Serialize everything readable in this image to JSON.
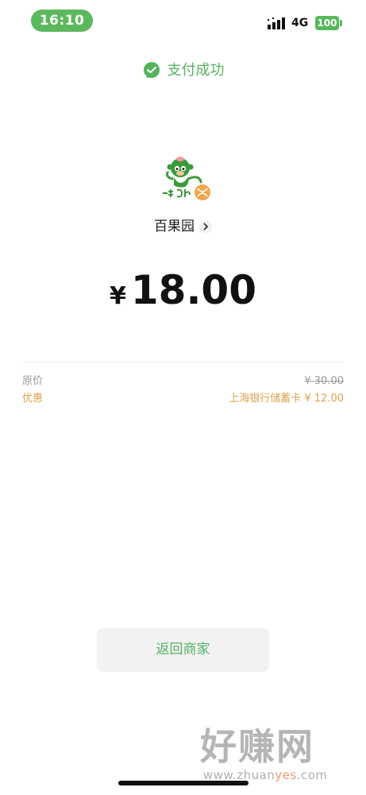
{
  "status_bar": {
    "time": "16:10",
    "network": "4G",
    "battery": "100",
    "signal_icon": "signal-bars-icon"
  },
  "header": {
    "icon": "wechat-pay-icon",
    "title": "支付成功"
  },
  "merchant": {
    "logo": "merchant-logo-monkey",
    "name": "百果园"
  },
  "payment": {
    "currency_symbol": "¥",
    "amount": "18.00"
  },
  "details": {
    "original_label": "原价",
    "original_value": "¥ 30.00",
    "discount_label": "优惠",
    "discount_value": "上海银行储蓄卡 ¥ 12.00"
  },
  "actions": {
    "return_label": "返回商家"
  },
  "watermark": {
    "text": "好赚网",
    "url_prefix": "www.zhuan",
    "url_highlight": "yes",
    "url_suffix": ".com"
  },
  "colors": {
    "success_green": "#55b35e",
    "discount_orange": "#e0a050",
    "button_bg": "#f2f2f2"
  }
}
